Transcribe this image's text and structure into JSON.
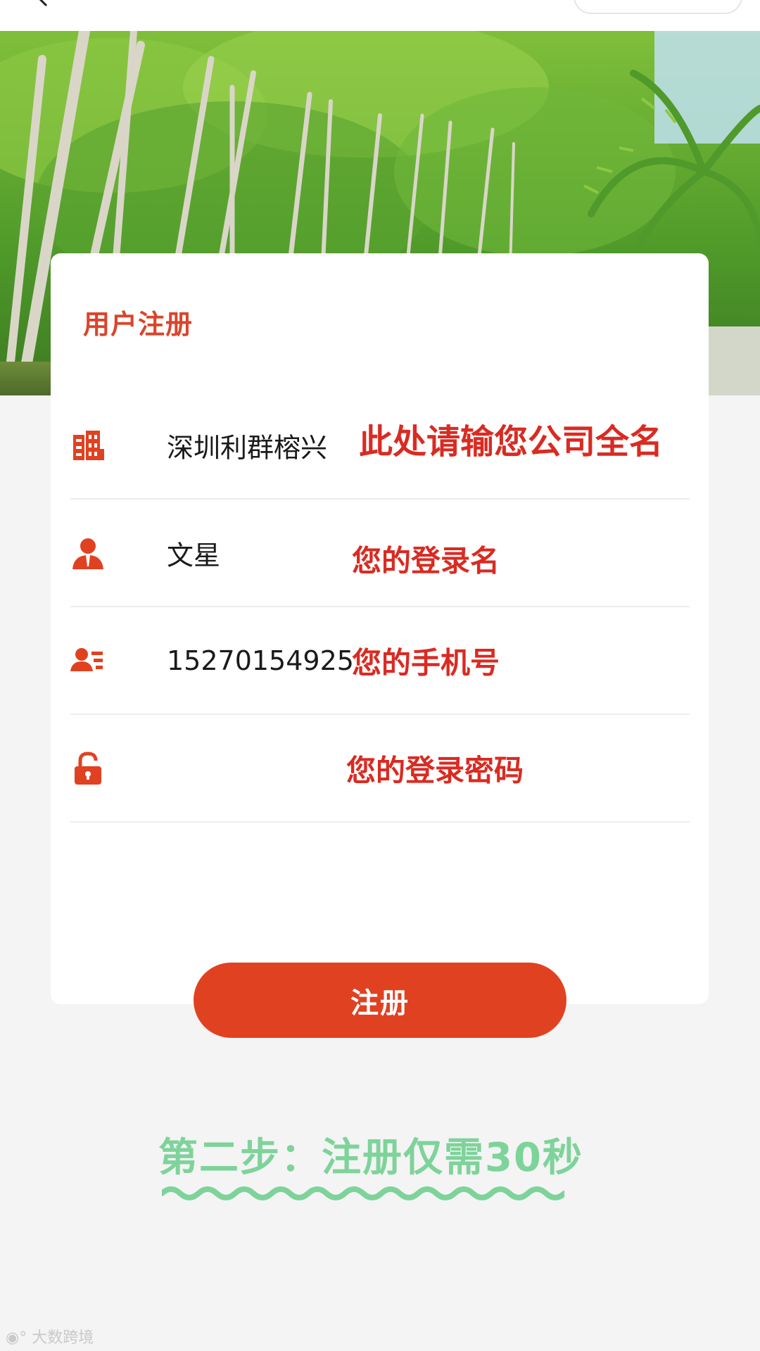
{
  "form": {
    "title": "用户注册",
    "fields": [
      {
        "icon": "building-icon",
        "value": "深圳利群榕兴",
        "hint": "此处请输您公司全名"
      },
      {
        "icon": "user-icon",
        "value": "文星",
        "hint": "您的登录名"
      },
      {
        "icon": "contact-card-icon",
        "value": "15270154925",
        "hint": "您的手机号"
      },
      {
        "icon": "unlock-icon",
        "value": "",
        "hint": "您的登录密码"
      }
    ],
    "submit_label": "注册"
  },
  "caption": "第二步：注册仅需30秒",
  "watermark": "大数跨境",
  "colors": {
    "accent": "#e04221",
    "caption": "#7ed39a"
  }
}
